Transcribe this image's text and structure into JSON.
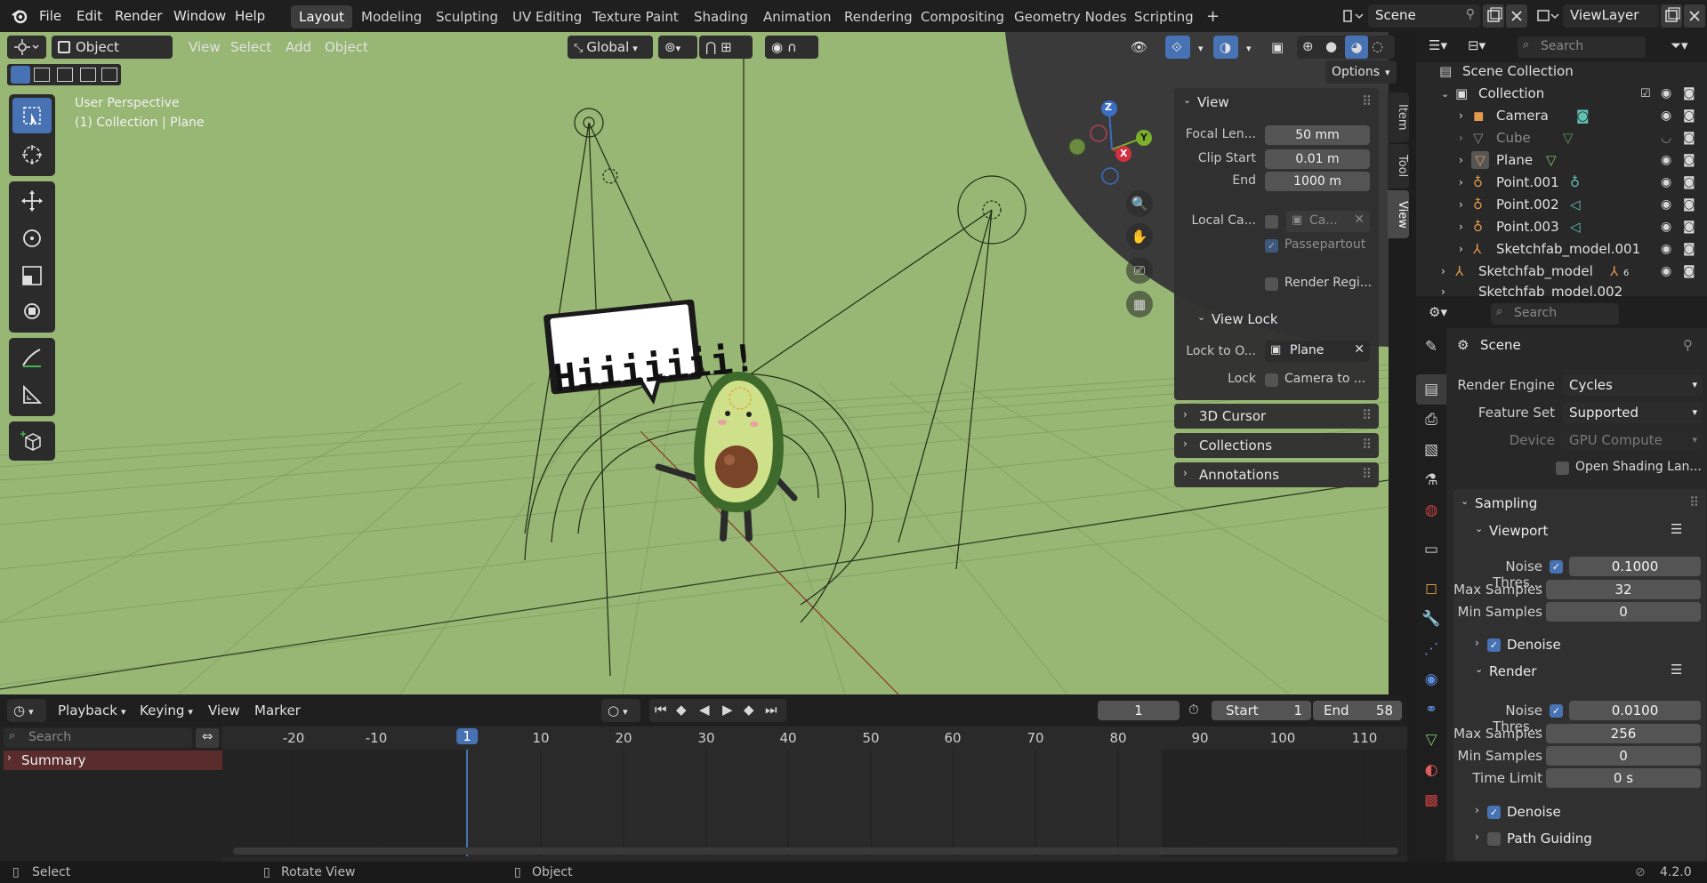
{
  "menubar": {
    "items": [
      "File",
      "Edit",
      "Render",
      "Window",
      "Help"
    ],
    "workspaces": [
      "Layout",
      "Modeling",
      "Sculpting",
      "UV Editing",
      "Texture Paint",
      "Shading",
      "Animation",
      "Rendering",
      "Compositing",
      "Geometry Nodes",
      "Scripting"
    ],
    "active_workspace": "Layout",
    "add_symbol": "+",
    "scene": "Scene",
    "view_layer": "ViewLayer"
  },
  "viewport_header": {
    "mode": "Object Mode",
    "menus": [
      "View",
      "Select",
      "Add",
      "Object"
    ],
    "orientation": "Global",
    "options": "Options"
  },
  "viewport": {
    "perspective": "User Perspective",
    "context": "(1) Collection | Plane",
    "speech_bubble": "Hiiiiiii!",
    "background_color": "#98b674",
    "gizmo_axes": [
      "Z",
      "Y",
      "X"
    ]
  },
  "npanel": {
    "tabs": [
      "Item",
      "Tool",
      "View"
    ],
    "view_title": "View",
    "focal_label": "Focal Len...",
    "focal_value": "50 mm",
    "clip_start_label": "Clip Start",
    "clip_start_value": "0.01 m",
    "clip_end_label": "End",
    "clip_end_value": "1000 m",
    "local_cam_label": "Local Ca...",
    "local_cam_value": "Ca...",
    "passepartout": "Passepartout",
    "render_region": "Render Regi...",
    "view_lock_title": "View Lock",
    "lock_obj_label": "Lock to O...",
    "lock_obj_value": "Plane",
    "lock_label": "Lock",
    "lock_value": "Camera to ...",
    "cursor_panel": "3D Cursor",
    "collections_panel": "Collections",
    "annotations_panel": "Annotations"
  },
  "outliner": {
    "search_placeholder": "Search",
    "scene_collection": "Scene Collection",
    "rows": [
      {
        "name": "Collection"
      },
      {
        "name": "Camera"
      },
      {
        "name": "Cube"
      },
      {
        "name": "Plane"
      },
      {
        "name": "Point.001"
      },
      {
        "name": "Point.002"
      },
      {
        "name": "Point.003"
      },
      {
        "name": "Sketchfab_model.001"
      },
      {
        "name": "Sketchfab_model"
      },
      {
        "name": "Sketchfab_model.002"
      }
    ],
    "sketchfab_count": "6"
  },
  "properties": {
    "search_placeholder": "Search",
    "context": "Scene",
    "render_engine_label": "Render Engine",
    "render_engine": "Cycles",
    "feature_set_label": "Feature Set",
    "feature_set": "Supported",
    "device_label": "Device",
    "device": "GPU Compute",
    "osl": "Open Shading Lan...",
    "sampling": "Sampling",
    "viewport": "Viewport",
    "noise_label": "Noise Thres...",
    "vp_noise": "0.1000",
    "max_samples_label": "Max Samples",
    "vp_max": "32",
    "min_samples_label": "Min Samples",
    "vp_min": "0",
    "denoise": "Denoise",
    "render": "Render",
    "r_noise": "0.0100",
    "r_max": "256",
    "r_min": "0",
    "time_limit_label": "Time Limit",
    "time_limit": "0 s",
    "path_guiding": "Path Guiding"
  },
  "timeline": {
    "menus": [
      "Playback",
      "Keying",
      "View",
      "Marker"
    ],
    "current_frame": "1",
    "start_label": "Start",
    "start": "1",
    "end_label": "End",
    "end": "58",
    "search_placeholder": "Search",
    "summary": "Summary",
    "ticks": [
      "-20",
      "-10",
      "1",
      "10",
      "20",
      "30",
      "40",
      "50",
      "60",
      "70",
      "80",
      "90",
      "100",
      "110"
    ]
  },
  "statusbar": {
    "select": "Select",
    "rotate": "Rotate View",
    "object": "Object",
    "version": "4.2.0"
  }
}
